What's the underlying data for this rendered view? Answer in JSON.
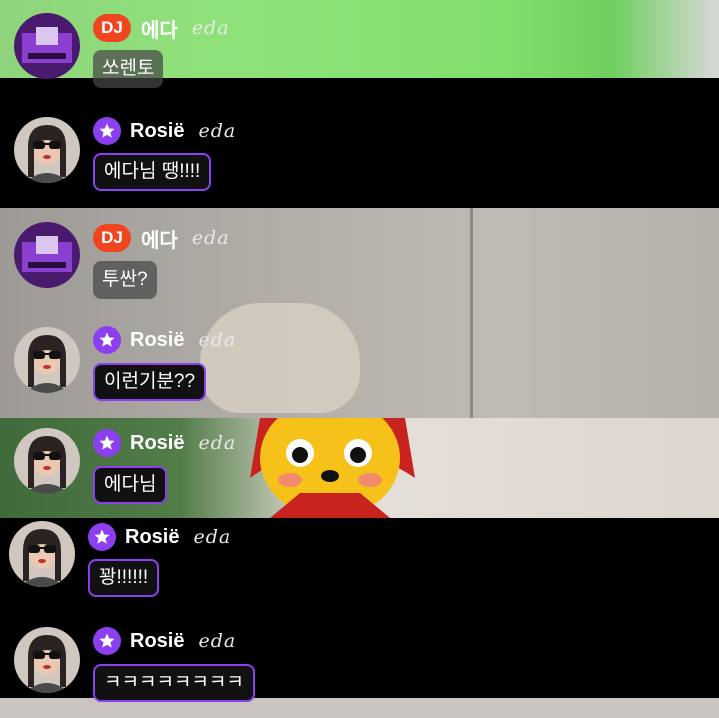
{
  "chat": {
    "messages": [
      {
        "id": "m1",
        "type": "dj",
        "badge": "DJ",
        "name": "에다",
        "subtitle": "eda",
        "text": "쏘렌토"
      },
      {
        "id": "m2",
        "type": "member",
        "name": "Rosië",
        "subtitle": "eda",
        "text": "에다님 땡!!!!"
      },
      {
        "id": "m3",
        "type": "dj",
        "badge": "DJ",
        "name": "에다",
        "subtitle": "eda",
        "text": "투싼?"
      },
      {
        "id": "m4",
        "type": "member",
        "name": "Rosië",
        "subtitle": "eda",
        "text": "이런기분??"
      },
      {
        "id": "m5",
        "type": "member",
        "name": "Rosië",
        "subtitle": "eda",
        "text": "에다님"
      },
      {
        "id": "m6",
        "type": "member",
        "name": "Rosië",
        "subtitle": "eda",
        "text": "꽝!!!!!!"
      },
      {
        "id": "m7",
        "type": "member",
        "name": "Rosië",
        "subtitle": "eda",
        "text": "ㅋㅋㅋㅋㅋㅋㅋㅋ"
      }
    ]
  },
  "colors": {
    "dj_badge": "#f0451f",
    "member_badge": "#8c3ff0",
    "bubble_border": "#8c3ff0",
    "background_green": "#7fe06a"
  },
  "icons": {
    "member_badge": "star-icon",
    "dj_avatar": "dj-avatar-icon",
    "member_avatar": "member-avatar-icon"
  }
}
